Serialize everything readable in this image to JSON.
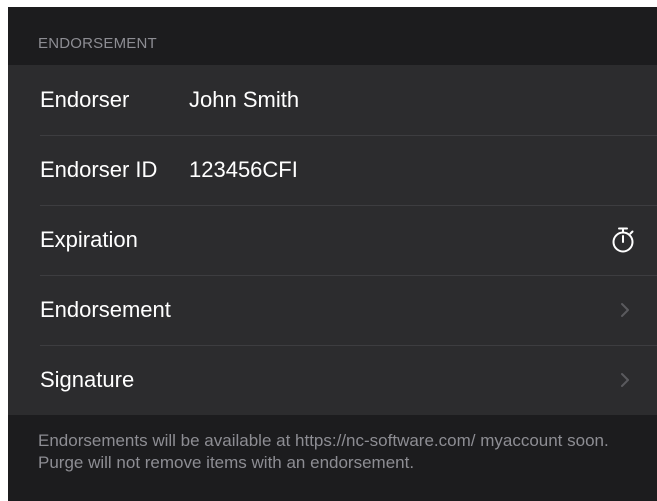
{
  "section": {
    "header": "ENDORSEMENT",
    "footer": "Endorsements will be available at https://nc-software.com/ myaccount soon. Purge will not remove items with an endorsement."
  },
  "rows": {
    "endorser": {
      "label": "Endorser",
      "value": "John Smith"
    },
    "endorser_id": {
      "label": "Endorser ID",
      "value": "123456CFI"
    },
    "expiration": {
      "label": "Expiration",
      "icon": "stopwatch-icon"
    },
    "endorsement": {
      "label": "Endorsement",
      "icon": "chevron-right-icon"
    },
    "signature": {
      "label": "Signature",
      "icon": "chevron-right-icon"
    }
  },
  "colors": {
    "background": "#1c1c1e",
    "cell": "#2c2c2e",
    "separator": "#3d3d40",
    "secondary_text": "#8d8d93",
    "primary_text": "#ffffff",
    "chevron": "#5a5a5e"
  }
}
